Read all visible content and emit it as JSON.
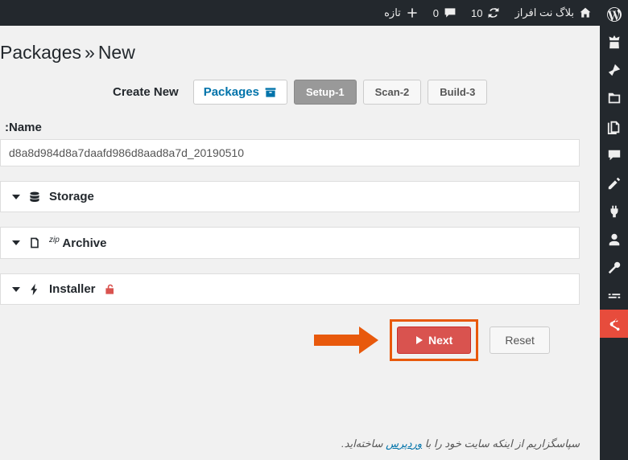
{
  "toolbar": {
    "site_name": "بلاگ نت افراز",
    "updates_count": "10",
    "comments_count": "0",
    "new_label": "تازه"
  },
  "page_title": {
    "main": "Packages",
    "sep": "»",
    "sub": "New"
  },
  "tabs": {
    "create_new": "Create New",
    "packages": "Packages",
    "step1": "Setup",
    "step1_num": "-1",
    "step2": "Scan",
    "step2_num": "-2",
    "step3": "Build",
    "step3_num": "-3"
  },
  "name_label": "Name",
  "name_value": "d8a8d984d8a7daafd986d8aad8a7d_20190510",
  "sections": {
    "storage": "Storage",
    "archive": "Archive",
    "archive_zip": "zip",
    "installer": "Installer"
  },
  "buttons": {
    "next": "Next",
    "reset": "Reset"
  },
  "footer": {
    "t1": "سپاسگزاریم از اینکه سایت خود را با ",
    "link": "وردپرس",
    "t2": " ساخته‌اید."
  }
}
